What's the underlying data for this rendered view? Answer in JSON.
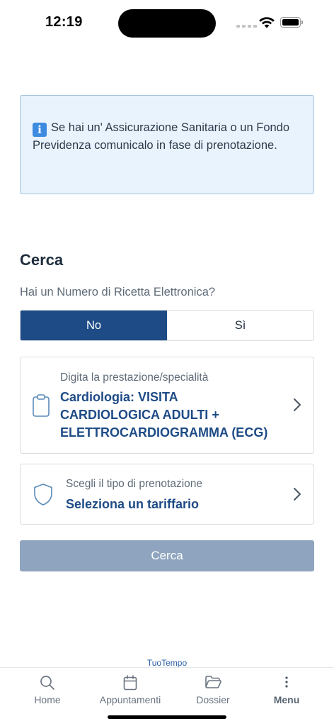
{
  "status_bar": {
    "time": "12:19"
  },
  "info": {
    "text": "Se hai un' Assicurazione Sanitaria o un Fondo Previdenza comunicalo in fase di prenotazione.",
    "icon": "info-icon",
    "colors": {
      "background": "#e9f3fd",
      "border": "#9fc4e2",
      "icon": "#3d8be0"
    }
  },
  "search": {
    "title": "Cerca",
    "question": "Hai un Numero di Ricetta Elettronica?",
    "options": [
      {
        "label": "No",
        "selected": true
      },
      {
        "label": "Sì",
        "selected": false
      }
    ],
    "service_card": {
      "label": "Digita la prestazione/specialità",
      "value": "Cardiologia: VISITA CARDIOLOGICA ADULTI + ELETTROCARDIOGRAMMA (ECG)",
      "icon": "clipboard-icon"
    },
    "tariff_card": {
      "label": "Scegli il tipo di prenotazione",
      "value": "Seleziona un tariffario",
      "icon": "shield-icon"
    },
    "button_label": "Cerca",
    "colors": {
      "primary": "#1e4b86",
      "button_disabled": "#8fa5bf"
    }
  },
  "brand": "TuoTempo",
  "tab_bar": {
    "items": [
      {
        "label": "Home",
        "icon": "search-icon"
      },
      {
        "label": "Appuntamenti",
        "icon": "calendar-icon"
      },
      {
        "label": "Dossier",
        "icon": "folder-icon"
      },
      {
        "label": "Menu",
        "icon": "more-vertical-icon"
      }
    ]
  }
}
